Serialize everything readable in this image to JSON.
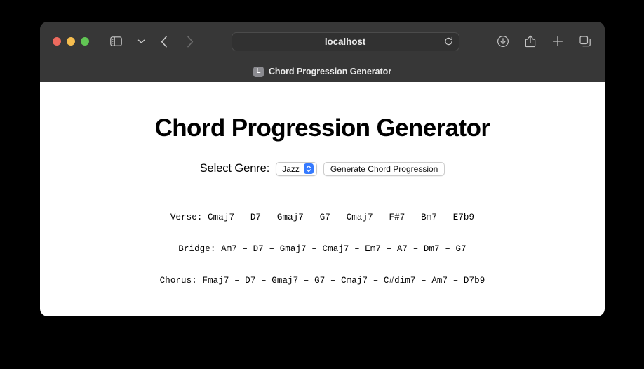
{
  "browser": {
    "traffic_lights": [
      {
        "name": "close",
        "color": "#ED6A5E"
      },
      {
        "name": "minimize",
        "color": "#F5BD4F"
      },
      {
        "name": "maximize",
        "color": "#61C554"
      }
    ],
    "address_bar": {
      "value": "localhost",
      "placeholder": "Search or enter website name",
      "reload_icon": "reload-icon"
    },
    "nav": {
      "sidebar_icon": "sidebar-toggle-icon",
      "chevron_icon": "chevron-down-icon",
      "back_icon": "back-chevron-icon",
      "forward_icon": "forward-chevron-icon"
    },
    "right_icons": [
      {
        "name": "downloads-icon"
      },
      {
        "name": "share-icon"
      },
      {
        "name": "new-tab-icon"
      },
      {
        "name": "tab-overview-icon"
      }
    ],
    "tab": {
      "favicon_letter": "L",
      "title": "Chord Progression Generator"
    }
  },
  "page": {
    "title": "Chord Progression Generator",
    "controls": {
      "genre_label": "Select Genre:",
      "genre_value": "Jazz",
      "genre_options": [
        "Jazz"
      ],
      "generate_button": "Generate Chord Progression"
    },
    "progression": {
      "verse": "Verse: Cmaj7 – D7 – Gmaj7 – G7 – Cmaj7 – F#7 – Bm7 – E7b9",
      "bridge": "Bridge: Am7 – D7 – Gmaj7 – Cmaj7 – Em7 – A7 – Dm7 – G7",
      "chorus": "Chorus: Fmaj7 – D7 – Gmaj7 – G7 – Cmaj7 – C#dim7 – Am7 – D7b9"
    }
  }
}
